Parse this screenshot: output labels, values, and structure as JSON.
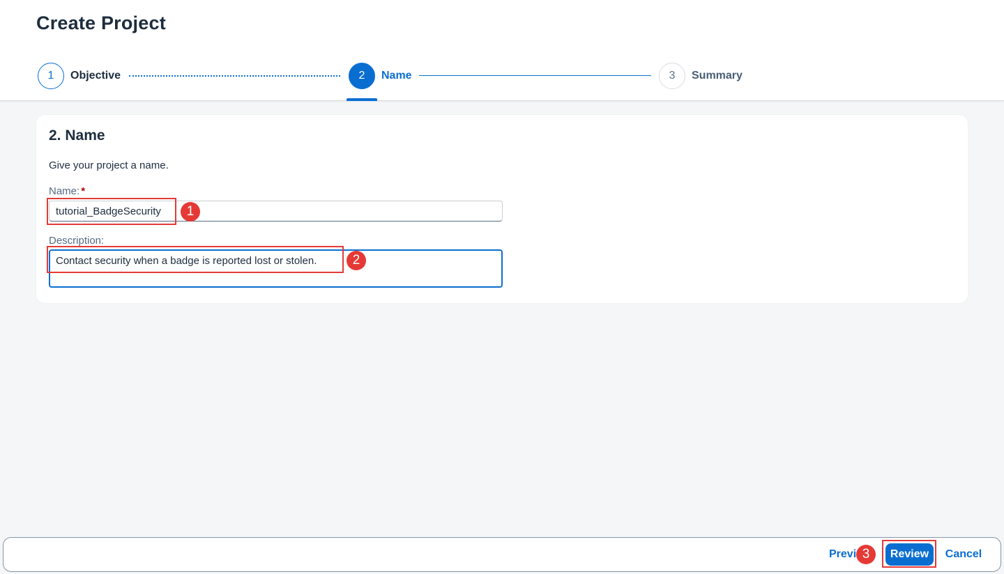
{
  "header": {
    "title": "Create Project"
  },
  "steps": [
    {
      "number": "1",
      "label": "Objective",
      "state": "completed"
    },
    {
      "number": "2",
      "label": "Name",
      "state": "active"
    },
    {
      "number": "3",
      "label": "Summary",
      "state": "pending"
    }
  ],
  "form": {
    "section_title": "2. Name",
    "section_description": "Give your project a name.",
    "name_label": "Name:",
    "name_required_mark": "*",
    "name_value": "tutorial_BadgeSecurity",
    "description_label": "Description:",
    "description_value": "Contact security when a badge is reported lost or stolen."
  },
  "annotations": {
    "badge_1": "1",
    "badge_2": "2",
    "badge_3": "3"
  },
  "footer": {
    "previous_label": "Previous",
    "review_label": "Review",
    "cancel_label": "Cancel"
  },
  "colors": {
    "accent": "#0a6ed1",
    "annotation": "#e53935",
    "background": "#f5f6f7"
  }
}
